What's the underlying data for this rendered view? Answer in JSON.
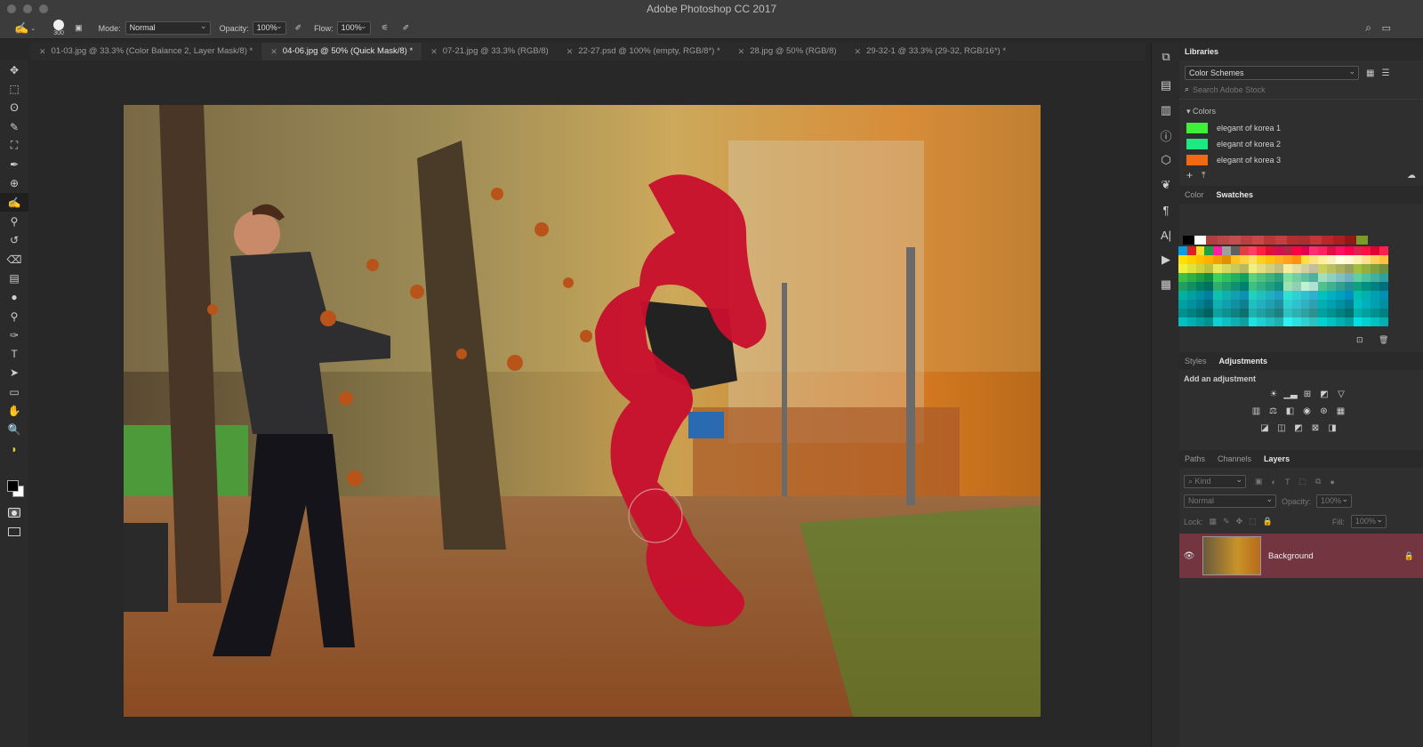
{
  "app": {
    "title": "Adobe Photoshop CC 2017"
  },
  "options_bar": {
    "brush_size": "300",
    "mode_label": "Mode:",
    "mode_value": "Normal",
    "opacity_label": "Opacity:",
    "opacity_value": "100%",
    "flow_label": "Flow:",
    "flow_value": "100%"
  },
  "tabs": [
    {
      "label": "01-03.jpg @ 33.3% (Color Balance 2, Layer Mask/8) *",
      "active": false
    },
    {
      "label": "04-06.jpg @ 50% (Quick Mask/8) *",
      "active": true
    },
    {
      "label": "07-21.jpg @ 33.3% (RGB/8)",
      "active": false
    },
    {
      "label": "22-27.psd @ 100% (empty, RGB/8*) *",
      "active": false
    },
    {
      "label": "28.jpg @ 50% (RGB/8)",
      "active": false
    },
    {
      "label": "29-32-1 @ 33.3% (29-32, RGB/16*) *",
      "active": false
    }
  ],
  "tools": [
    "move-tool-icon",
    "marquee-tool-icon",
    "lasso-tool-icon",
    "quick-selection-tool-icon",
    "crop-tool-icon",
    "eyedropper-tool-icon",
    "spot-healing-tool-icon",
    "brush-tool-icon",
    "clone-stamp-tool-icon",
    "history-brush-tool-icon",
    "eraser-tool-icon",
    "gradient-tool-icon",
    "blur-tool-icon",
    "dodge-tool-icon",
    "pen-tool-icon",
    "type-tool-icon",
    "path-selection-tool-icon",
    "rectangle-tool-icon",
    "hand-tool-icon",
    "zoom-tool-icon",
    "banana-icon"
  ],
  "tool_glyphs": [
    "✥",
    "⬚",
    "ʘ",
    "✎",
    "⛶",
    "✒",
    "⊕",
    "✍",
    "⚲",
    "↺",
    "⌫",
    "▤",
    "●",
    "⚲",
    "✑",
    "T",
    "➤",
    "▭",
    "✋",
    "🔍",
    "◗"
  ],
  "libraries": {
    "tab_label": "Libraries",
    "dropdown": "Color Schemes",
    "search_placeholder": "Search Adobe Stock",
    "section": "Colors",
    "colors": [
      {
        "name": "elegant of korea 1",
        "hex": "#3ff03a"
      },
      {
        "name": "elegant of korea 2",
        "hex": "#1de882"
      },
      {
        "name": "elegant of korea 3",
        "hex": "#f16a12"
      }
    ]
  },
  "color_panel": {
    "tabs": [
      "Color",
      "Swatches"
    ],
    "active": "Swatches"
  },
  "adjustments_panel": {
    "tabs": [
      "Styles",
      "Adjustments"
    ],
    "active": "Adjustments",
    "hint": "Add an adjustment"
  },
  "layers_panel": {
    "tabs": [
      "Paths",
      "Channels",
      "Layers"
    ],
    "active": "Layers",
    "filter_label": "Kind",
    "blend_mode": "Normal",
    "opacity_label": "Opacity:",
    "opacity_value": "100%",
    "lock_label": "Lock:",
    "fill_label": "Fill:",
    "fill_value": "100%",
    "layers": [
      {
        "name": "Background",
        "visible": true,
        "locked": true
      }
    ]
  },
  "colors": {
    "quick_mask": "#c8102e",
    "layer_selected": "#733540"
  }
}
